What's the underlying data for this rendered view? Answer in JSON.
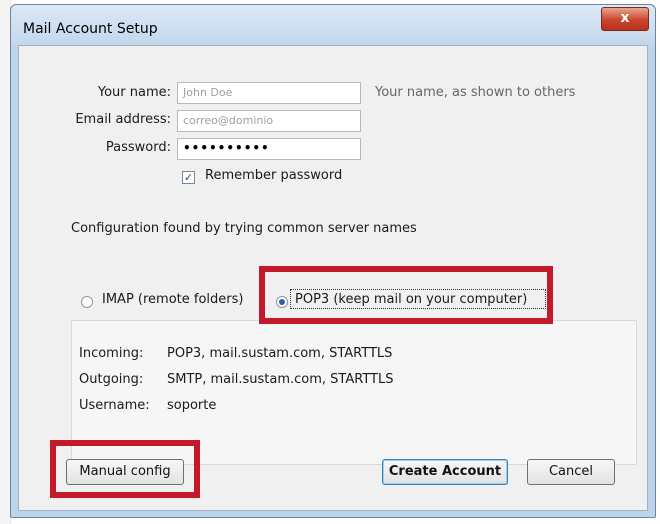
{
  "window": {
    "title": "Mail Account Setup",
    "close_glyph": "x"
  },
  "form": {
    "name_label": "Your name:",
    "name_value": "John Doe",
    "name_hint": "Your name, as shown to others",
    "email_label": "Email address:",
    "email_value": "correo@dominio",
    "password_label": "Password:",
    "password_value": "••••••••••",
    "remember_label": "Remember password",
    "remember_checked": true
  },
  "status": {
    "message": "Configuration found by trying common server names"
  },
  "protocol": {
    "imap_label": "IMAP (remote folders)",
    "pop3_label": "POP3 (keep mail on your computer)",
    "selected": "POP3"
  },
  "servers": {
    "incoming_label": "Incoming:",
    "incoming_value": "POP3, mail.sustam.com, STARTTLS",
    "outgoing_label": "Outgoing:",
    "outgoing_value": "SMTP, mail.sustam.com, STARTTLS",
    "username_label": "Username:",
    "username_value": "soporte"
  },
  "buttons": {
    "manual_config": "Manual config",
    "create_account": "Create Account",
    "cancel": "Cancel"
  },
  "colors": {
    "highlight": "#c21a2b",
    "titlebar": "#c3d7ec",
    "close_button": "#c8452c"
  }
}
